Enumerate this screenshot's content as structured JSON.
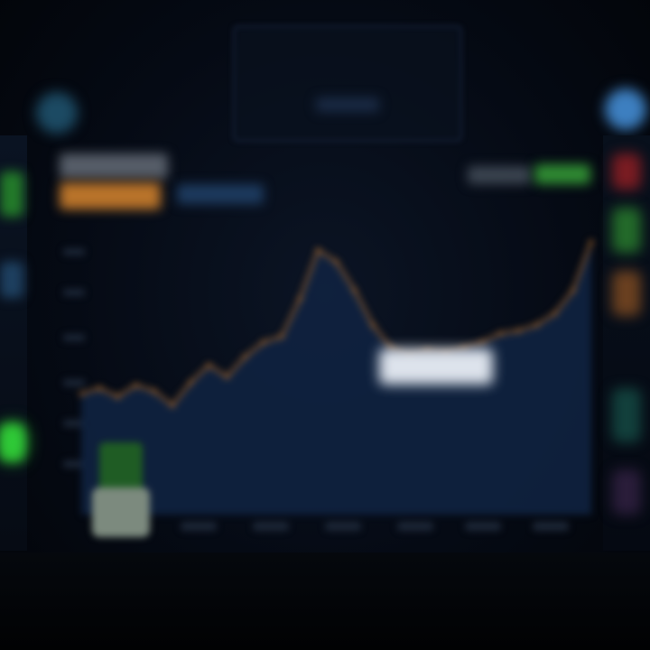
{
  "colors": {
    "background": "#03060c",
    "panel_border": "#16223a",
    "area_fill": "#0f2240",
    "line": "#c0752d",
    "accent_green": "#2fa82f",
    "accent_orange": "#c47a2a",
    "accent_blue": "#3d7fc0",
    "accent_red": "#a0262c",
    "badge": "#dde3ec"
  },
  "icons": {
    "left_round_button": "circle-button-icon",
    "right_round_button": "circle-button-icon"
  },
  "chart_data": {
    "type": "area",
    "x": [
      0,
      1,
      2,
      3,
      4,
      5,
      6,
      7,
      8,
      9,
      10,
      11,
      12,
      13,
      14,
      15,
      16,
      17,
      18,
      19,
      20,
      21,
      22,
      23,
      24,
      25,
      26,
      27,
      28
    ],
    "values": [
      42,
      44,
      41,
      45,
      43,
      38,
      46,
      52,
      48,
      55,
      60,
      62,
      75,
      92,
      88,
      78,
      66,
      58,
      55,
      57,
      56,
      58,
      60,
      63,
      64,
      66,
      70,
      78,
      95
    ],
    "ylim": [
      0,
      110
    ],
    "grid": false
  }
}
